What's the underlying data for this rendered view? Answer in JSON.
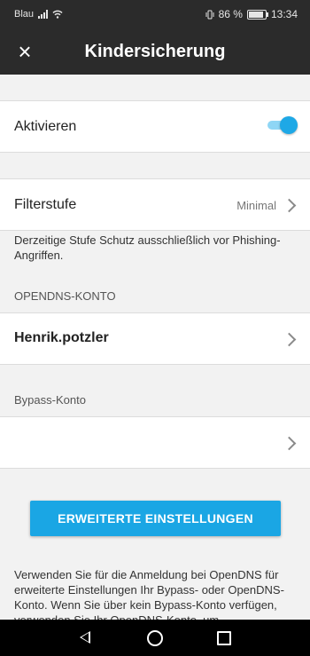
{
  "status_bar": {
    "carrier": "Blau",
    "battery": "86 %",
    "time": "13:34"
  },
  "app_bar": {
    "close_icon": "×",
    "title": "Kindersicherung"
  },
  "activate": {
    "label": "Aktivieren",
    "enabled": true
  },
  "filter": {
    "label": "Filterstufe",
    "value": "Minimal",
    "description": "Derzeitige Stufe Schutz ausschließlich vor Phishing-Angriffen."
  },
  "opendns": {
    "header": "OPENDNS-KONTO",
    "account": "Henrik.potzler"
  },
  "bypass": {
    "header": "Bypass-Konto",
    "account": ""
  },
  "advanced_button": {
    "label": "ERWEITERTE EINSTELLUNGEN"
  },
  "footer": {
    "text": "Verwenden Sie für die Anmeldung bei OpenDNS für erweiterte Einstellungen Ihr Bypass- oder OpenDNS-Konto. Wenn Sie über kein Bypass-Konto verfügen, verwenden Sie Ihr OpenDNS-Konto, um"
  },
  "colors": {
    "accent": "#1aa6e4",
    "app_bar": "#2b2b2b",
    "background": "#f2f2f2"
  }
}
